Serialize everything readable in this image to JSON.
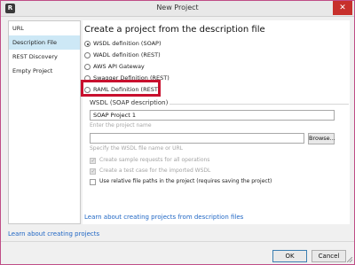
{
  "window": {
    "title": "New Project",
    "app_icon_letter": "R",
    "close_glyph": "✕"
  },
  "nav": {
    "items": [
      {
        "label": "URL",
        "active": false
      },
      {
        "label": "Description File",
        "active": true
      },
      {
        "label": "REST Discovery",
        "active": false
      },
      {
        "label": "Empty Project",
        "active": false
      }
    ]
  },
  "main": {
    "heading": "Create a project from the description file",
    "options": [
      {
        "label": "WSDL definition (SOAP)",
        "selected": true
      },
      {
        "label": "WADL definition (REST)",
        "selected": false
      },
      {
        "label": "AWS API Gateway",
        "selected": false
      },
      {
        "label": "Swagger Definition (REST)",
        "selected": false
      },
      {
        "label": "RAML Definition (REST)",
        "selected": false
      }
    ],
    "section_title": "WSDL (SOAP description)",
    "project_name": {
      "value": "SOAP Project 1",
      "hint": "Enter the project name"
    },
    "wsdl_file": {
      "value": "",
      "hint": "Specify the WSDL file name or URL",
      "browse_label": "Browse..."
    },
    "checkboxes": [
      {
        "label": "Create sample requests for all operations",
        "checked": true,
        "enabled": false
      },
      {
        "label": "Create a test case for the imported WSDL",
        "checked": true,
        "enabled": false
      },
      {
        "label": "Use relative file paths in the project (requires saving the project)",
        "checked": false,
        "enabled": true
      }
    ],
    "learn_link": "Learn about creating projects from description files"
  },
  "footer": {
    "learn_link": "Learn about creating projects",
    "ok_label": "OK",
    "cancel_label": "Cancel"
  },
  "colors": {
    "highlight": "#c8102e",
    "link": "#1f66c4",
    "nav_active": "#cde8f6",
    "close": "#c7302c"
  }
}
